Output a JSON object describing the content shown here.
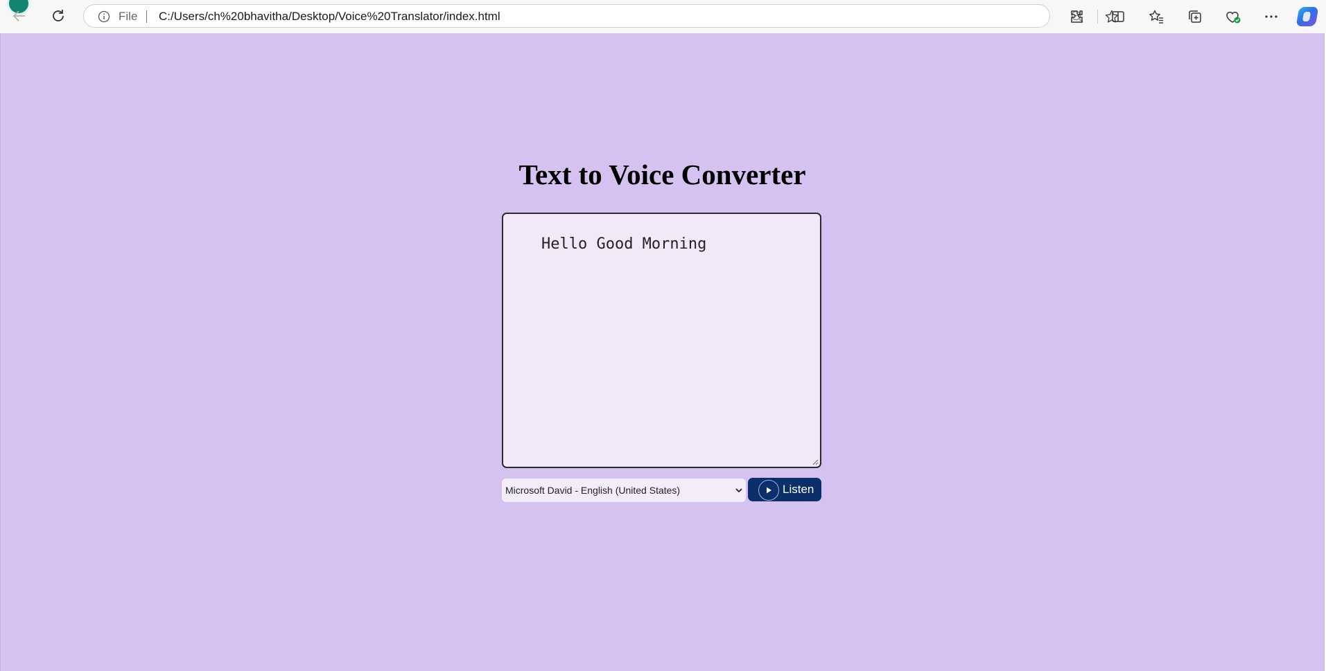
{
  "browser": {
    "address_scheme": "File",
    "url": "C:/Users/ch%20bhavitha/Desktop/Voice%20Translator/index.html"
  },
  "page": {
    "background": "#d6c2f0",
    "title": "Text to Voice Converter",
    "textarea_value": "Hello Good Morning",
    "voice_selected": "Microsoft David - English (United States)",
    "listen_label": "Listen",
    "button_color": "#0b2f6b"
  }
}
